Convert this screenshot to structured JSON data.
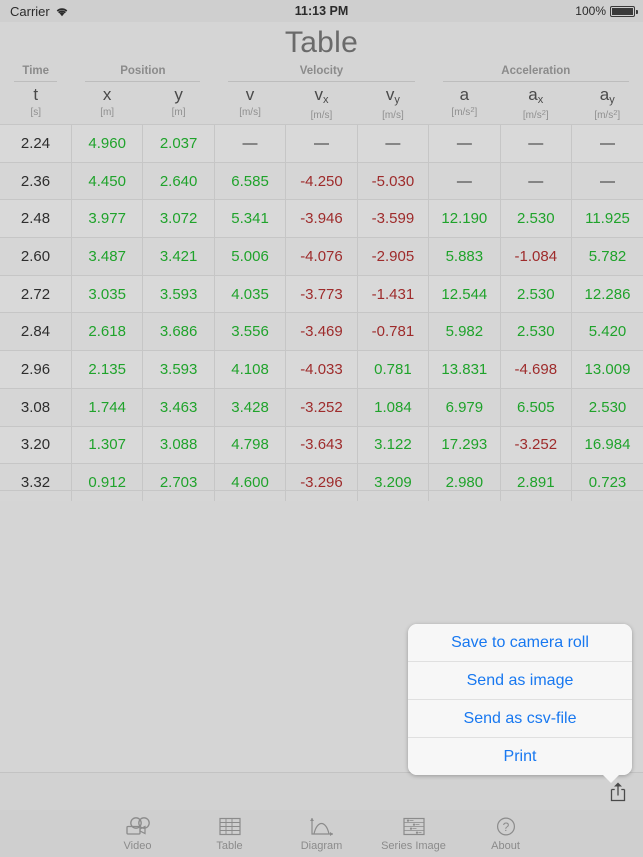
{
  "status_bar": {
    "carrier": "Carrier",
    "wifi_icon": "wifi-icon",
    "time": "11:13 PM",
    "battery_percent": "100%",
    "battery_icon": "battery-full-icon"
  },
  "header": {
    "title": "Table"
  },
  "table": {
    "groups": [
      {
        "label": "Time",
        "span": 1
      },
      {
        "label": "Position",
        "span": 2
      },
      {
        "label": "Velocity",
        "span": 3
      },
      {
        "label": "Acceleration",
        "span": 3
      }
    ],
    "columns": [
      {
        "symbol": "t",
        "sub": "",
        "unit": "[s]",
        "unit_sup": ""
      },
      {
        "symbol": "x",
        "sub": "",
        "unit": "[m]",
        "unit_sup": ""
      },
      {
        "symbol": "y",
        "sub": "",
        "unit": "[m]",
        "unit_sup": ""
      },
      {
        "symbol": "v",
        "sub": "",
        "unit": "[m/s]",
        "unit_sup": ""
      },
      {
        "symbol": "v",
        "sub": "x",
        "unit": "[m/s]",
        "unit_sup": ""
      },
      {
        "symbol": "v",
        "sub": "y",
        "unit": "[m/s]",
        "unit_sup": ""
      },
      {
        "symbol": "a",
        "sub": "",
        "unit": "[m/s",
        "unit_sup": "2"
      },
      {
        "symbol": "a",
        "sub": "x",
        "unit": "[m/s",
        "unit_sup": "2"
      },
      {
        "symbol": "a",
        "sub": "y",
        "unit": "[m/s",
        "unit_sup": "2"
      }
    ],
    "rows": [
      [
        "2.24",
        "4.960",
        "2.037",
        "—",
        "—",
        "—",
        "—",
        "—",
        "—"
      ],
      [
        "2.36",
        "4.450",
        "2.640",
        "6.585",
        "-4.250",
        "-5.030",
        "—",
        "—",
        "—"
      ],
      [
        "2.48",
        "3.977",
        "3.072",
        "5.341",
        "-3.946",
        "-3.599",
        "12.190",
        "2.530",
        "11.925"
      ],
      [
        "2.60",
        "3.487",
        "3.421",
        "5.006",
        "-4.076",
        "-2.905",
        "5.883",
        "-1.084",
        "5.782"
      ],
      [
        "2.72",
        "3.035",
        "3.593",
        "4.035",
        "-3.773",
        "-1.431",
        "12.544",
        "2.530",
        "12.286"
      ],
      [
        "2.84",
        "2.618",
        "3.686",
        "3.556",
        "-3.469",
        "-0.781",
        "5.982",
        "2.530",
        "5.420"
      ],
      [
        "2.96",
        "2.135",
        "3.593",
        "4.108",
        "-4.033",
        "0.781",
        "13.831",
        "-4.698",
        "13.009"
      ],
      [
        "3.08",
        "1.744",
        "3.463",
        "3.428",
        "-3.252",
        "1.084",
        "6.979",
        "6.505",
        "2.530"
      ],
      [
        "3.20",
        "1.307",
        "3.088",
        "4.798",
        "-3.643",
        "3.122",
        "17.293",
        "-3.252",
        "16.984"
      ],
      [
        "3.32",
        "0.912",
        "2.703",
        "4.600",
        "-3.296",
        "3.209",
        "2.980",
        "2.891",
        "0.723"
      ]
    ]
  },
  "chart_data": {
    "type": "table",
    "title": "Table",
    "column_groups": [
      "Time",
      "Position",
      "Velocity",
      "Acceleration"
    ],
    "columns": [
      "t [s]",
      "x [m]",
      "y [m]",
      "v [m/s]",
      "vx [m/s]",
      "vy [m/s]",
      "a [m/s2]",
      "ax [m/s2]",
      "ay [m/s2]"
    ],
    "rows": [
      [
        2.24,
        4.96,
        2.037,
        null,
        null,
        null,
        null,
        null,
        null
      ],
      [
        2.36,
        4.45,
        2.64,
        6.585,
        -4.25,
        -5.03,
        null,
        null,
        null
      ],
      [
        2.48,
        3.977,
        3.072,
        5.341,
        -3.946,
        -3.599,
        12.19,
        2.53,
        11.925
      ],
      [
        2.6,
        3.487,
        3.421,
        5.006,
        -4.076,
        -2.905,
        5.883,
        -1.084,
        5.782
      ],
      [
        2.72,
        3.035,
        3.593,
        4.035,
        -3.773,
        -1.431,
        12.544,
        2.53,
        12.286
      ],
      [
        2.84,
        2.618,
        3.686,
        3.556,
        -3.469,
        -0.781,
        5.982,
        2.53,
        5.42
      ],
      [
        2.96,
        2.135,
        3.593,
        4.108,
        -4.033,
        0.781,
        13.831,
        -4.698,
        13.009
      ],
      [
        3.08,
        1.744,
        3.463,
        3.428,
        -3.252,
        1.084,
        6.979,
        6.505,
        2.53
      ],
      [
        3.2,
        1.307,
        3.088,
        4.798,
        -3.643,
        3.122,
        17.293,
        -3.252,
        16.984
      ],
      [
        3.32,
        0.912,
        2.703,
        4.6,
        -3.296,
        3.209,
        2.98,
        2.891,
        0.723
      ]
    ],
    "missing_marker": "—"
  },
  "popover": {
    "items": [
      "Save to camera roll",
      "Send as image",
      "Send as csv-file",
      "Print"
    ]
  },
  "toolbar": {
    "share_icon": "share-icon"
  },
  "tabbar": {
    "items": [
      {
        "label": "Video",
        "icon": "video-camera-icon",
        "active": false
      },
      {
        "label": "Table",
        "icon": "table-grid-icon",
        "active": true
      },
      {
        "label": "Diagram",
        "icon": "diagram-curve-icon",
        "active": false
      },
      {
        "label": "Series Image",
        "icon": "series-image-icon",
        "active": false
      },
      {
        "label": "About",
        "icon": "question-circle-icon",
        "active": false
      }
    ]
  },
  "colors": {
    "positive": "#1fa32b",
    "negative": "#9e2b2b",
    "link": "#1878f0",
    "background": "#d5d5d5",
    "title": "#6a6a6a"
  }
}
